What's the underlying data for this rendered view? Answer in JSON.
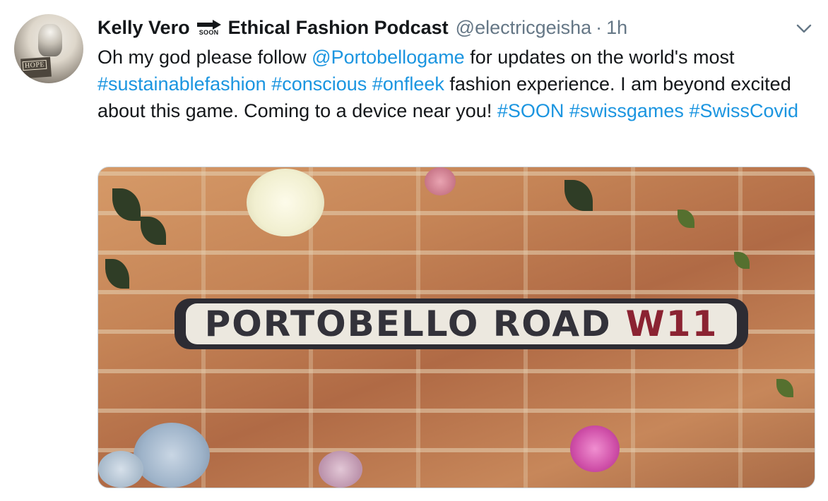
{
  "tweet": {
    "display_name": "Kelly Vero",
    "emoji_label": "SOON",
    "display_name_suffix": "Ethical Fashion Podcast",
    "handle": "@electricgeisha",
    "separator": "·",
    "time": "1h",
    "avatar_text": "HOPE",
    "text_segments": [
      {
        "text": "Oh my god please follow ",
        "type": "text"
      },
      {
        "text": "@Portobellogame",
        "type": "link"
      },
      {
        "text": " for updates on the world's most ",
        "type": "text"
      },
      {
        "text": "#sustainablefashion",
        "type": "link"
      },
      {
        "text": " ",
        "type": "text"
      },
      {
        "text": "#conscious",
        "type": "link"
      },
      {
        "text": " ",
        "type": "text"
      },
      {
        "text": "#onfleek",
        "type": "link"
      },
      {
        "text": " fashion experience. I am beyond excited about this game. Coming to a device near you! ",
        "type": "text"
      },
      {
        "text": "#SOON",
        "type": "link"
      },
      {
        "text": " ",
        "type": "text"
      },
      {
        "text": "#swissgames",
        "type": "link"
      },
      {
        "text": " ",
        "type": "text"
      },
      {
        "text": "#SwissCovid",
        "type": "link"
      }
    ],
    "media": {
      "sign_main": "PORTOBELLO ROAD",
      "sign_code": "W11"
    }
  },
  "colors": {
    "link": "#1b95e0",
    "secondary_text": "#657786",
    "primary_text": "#14171a"
  },
  "icons": {
    "options": "chevron-down-icon",
    "soon": "soon-arrow-icon"
  }
}
